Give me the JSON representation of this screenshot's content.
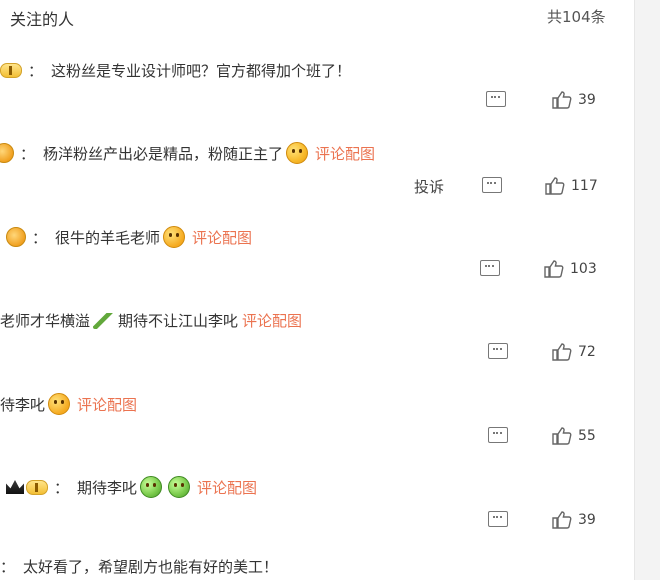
{
  "header": {
    "title": "关注的人",
    "count": "共104条"
  },
  "comments": [
    {
      "pre_badge": true,
      "text": "这粉丝是专业设计师吧？官方都得加个班了！",
      "like_count": "39"
    },
    {
      "pre_avatar": true,
      "text": "杨洋粉丝产出必是精品，粉随正主了",
      "pic_link": "评论配图",
      "report": "投诉",
      "like_count": "117"
    },
    {
      "pre_avatar": true,
      "text": "很牛的羊毛老师",
      "pic_link": "评论配图",
      "like_count": "103"
    },
    {
      "text_a": "老师才华横溢",
      "text_b": "期待不让江山李叱",
      "pic_link": "评论配图",
      "like_count": "72"
    },
    {
      "text": "待李叱",
      "pic_link": "评论配图",
      "like_count": "55"
    },
    {
      "text": "期待李叱",
      "pic_link": "评论配图",
      "like_count": "39"
    },
    {
      "text": "太好看了，希望剧方也能有好的美工！"
    }
  ],
  "icons": {
    "comment": "comment-icon",
    "like": "thumbs-up-icon",
    "emoji": "emoji-icon"
  },
  "colors": {
    "pic_link": "#eb7350",
    "text": "#333333"
  }
}
